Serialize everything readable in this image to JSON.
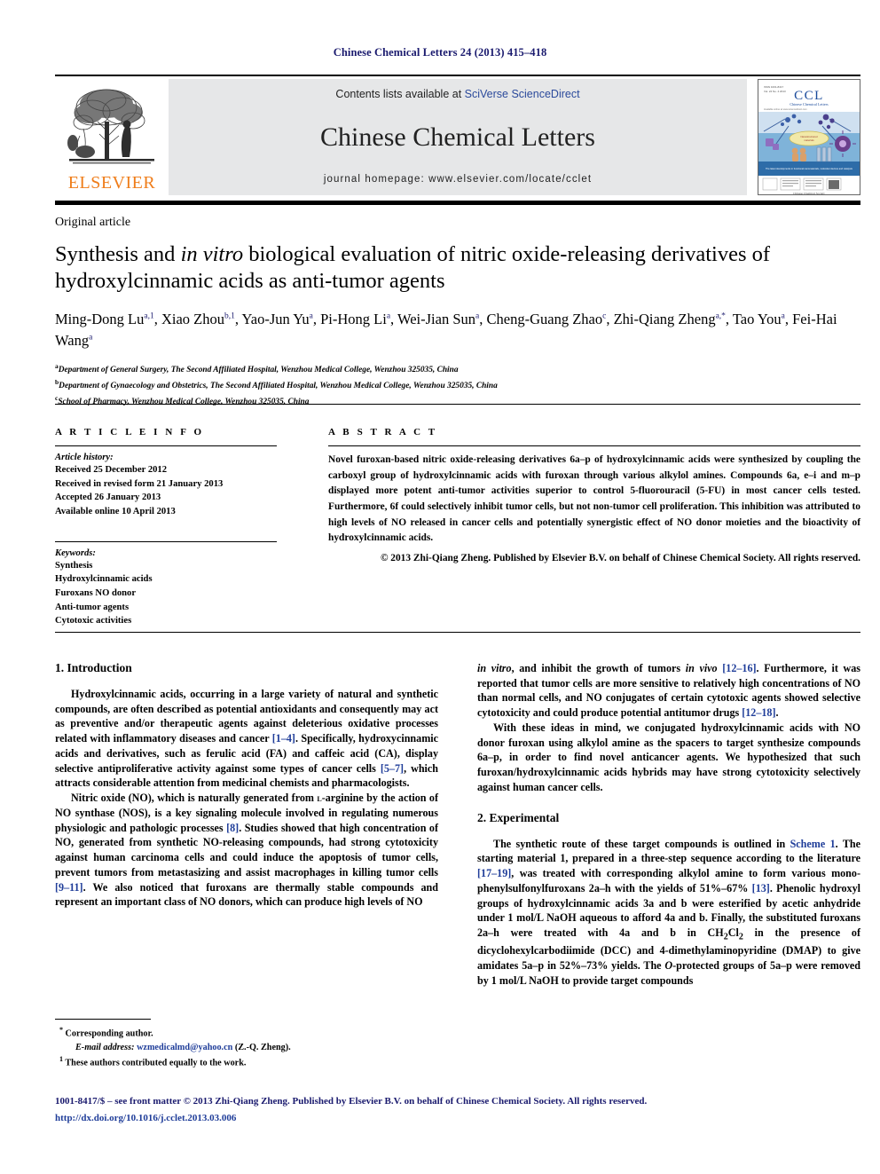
{
  "running_head": "Chinese Chemical Letters 24 (2013) 415–418",
  "masthead": {
    "contents_prefix": "Contents lists available at ",
    "sciencedirect_link": "SciVerse ScienceDirect",
    "journal_name": "Chinese Chemical Letters",
    "homepage": "journal homepage: www.elsevier.com/locate/cclet",
    "publisher_wordmark": "ELSEVIER",
    "cover_title": "CCL",
    "cover_subtitle": "Chinese Chemical Letters"
  },
  "article": {
    "type": "Original article",
    "title_part1": "Synthesis and ",
    "title_italic": "in vitro",
    "title_part2": " biological evaluation of nitric oxide-releasing derivatives of hydroxylcinnamic acids as anti-tumor agents",
    "authors": [
      {
        "name": "Ming-Dong Lu",
        "sup": "a,1",
        "sep": ", "
      },
      {
        "name": "Xiao Zhou",
        "sup": "b,1",
        "sep": ", "
      },
      {
        "name": "Yao-Jun Yu",
        "sup": "a",
        "sep": ", "
      },
      {
        "name": "Pi-Hong Li",
        "sup": "a",
        "sep": ", "
      },
      {
        "name": "Wei-Jian Sun",
        "sup": "a",
        "sep": ", "
      },
      {
        "name": "Cheng-Guang Zhao",
        "sup": "c",
        "sep": ", "
      },
      {
        "name": "Zhi-Qiang Zheng",
        "sup": "a,*",
        "sep": ", "
      },
      {
        "name": "Tao You",
        "sup": "a",
        "sep": ", "
      },
      {
        "name": "Fei-Hai Wang",
        "sup": "a",
        "sep": ""
      }
    ],
    "affiliations": [
      {
        "mark": "a",
        "text": "Department of General Surgery, The Second Affiliated Hospital, Wenzhou Medical College, Wenzhou 325035, China"
      },
      {
        "mark": "b",
        "text": "Department of Gynaecology and Obstetrics, The Second Affiliated Hospital, Wenzhou Medical College, Wenzhou 325035, China"
      },
      {
        "mark": "c",
        "text": "School of Pharmacy, Wenzhou Medical College, Wenzhou 325035, China"
      }
    ]
  },
  "article_info": {
    "heading": "A R T I C L E   I N F O",
    "history_label": "Article history:",
    "history": [
      "Received 25 December 2012",
      "Received in revised form 21 January 2013",
      "Accepted 26 January 2013",
      "Available online 10 April 2013"
    ],
    "keywords_label": "Keywords:",
    "keywords": [
      "Synthesis",
      "Hydroxylcinnamic acids",
      "Furoxans NO donor",
      "Anti-tumor agents",
      "Cytotoxic activities"
    ]
  },
  "abstract": {
    "heading": "A B S T R A C T",
    "body": "Novel furoxan-based nitric oxide-releasing derivatives 6a–p of hydroxylcinnamic acids were synthesized by coupling the carboxyl group of hydroxylcinnamic acids with furoxan through various alkylol amines. Compounds 6a, e–i and m–p displayed more potent anti-tumor activities superior to control 5-fluorouracil (5-FU) in most cancer cells tested. Furthermore, 6f could selectively inhibit tumor cells, but not non-tumor cell proliferation. This inhibition was attributed to high levels of NO released in cancer cells and potentially synergistic effect of NO donor moieties and the bioactivity of hydroxylcinnamic acids.",
    "copyright": "© 2013 Zhi-Qiang Zheng. Published by Elsevier B.V. on behalf of Chinese Chemical Society. All rights reserved."
  },
  "sections": {
    "intro_title": "1. Introduction",
    "intro_p1": "Hydroxylcinnamic acids, occurring in a large variety of natural and synthetic compounds, are often described as potential antioxidants and consequently may act as preventive and/or therapeutic agents against deleterious oxidative processes related with inflammatory diseases and cancer [1–4]. Specifically, hydroxycinnamic acids and derivatives, such as ferulic acid (FA) and caffeic acid (CA), display selective antiproliferative activity against some types of cancer cells [5–7], which attracts considerable attention from medicinal chemists and pharmacologists.",
    "intro_p2": "Nitric oxide (NO), which is naturally generated from L-arginine by the action of NO synthase (NOS), is a key signaling molecule involved in regulating numerous physiologic and pathologic processes [8]. Studies showed that high concentration of NO, generated from synthetic NO-releasing compounds, had strong cytotoxicity against human carcinoma cells and could induce the apoptosis of tumor cells, prevent tumors from metastasizing and assist macrophages in killing tumor cells [9–11]. We also noticed that furoxans are thermally stable compounds and represent an important class of NO donors, which can produce high levels of NO",
    "intro_p2_cont": "in vitro, and inhibit the growth of tumors in vivo [12–16]. Furthermore, it was reported that tumor cells are more sensitive to relatively high concentrations of NO than normal cells, and NO conjugates of certain cytotoxic agents showed selective cytotoxicity and could produce potential antitumor drugs [12–18].",
    "intro_p3": "With these ideas in mind, we conjugated hydroxylcinnamic acids with NO donor furoxan using alkylol amine as the spacers to target synthesize compounds 6a–p, in order to find novel anticancer agents. We hypothesized that such furoxan/hydroxylcinnamic acids hybrids may have strong cytotoxicity selectively against human cancer cells.",
    "exp_title": "2. Experimental",
    "exp_p1": "The synthetic route of these target compounds is outlined in Scheme 1. The starting material 1, prepared in a three-step sequence according to the literature [17–19], was treated with corresponding alkylol amine to form various mono-phenylsulfonylfuroxans 2a–h with the yields of 51%–67% [13]. Phenolic hydroxyl groups of hydroxylcinnamic acids 3a and b were esterified by acetic anhydride under 1 mol/L NaOH aqueous to afford 4a and b. Finally, the substituted furoxans 2a–h were treated with 4a and b in CH2Cl2 in the presence of dicyclohexylcarbodiimide (DCC) and 4-dimethylaminopyridine (DMAP) to give amidates 5a–p in 52%–73% yields. The O-protected groups of 5a–p were removed by 1 mol/L NaOH to provide target compounds"
  },
  "footnotes": {
    "corresponding": "Corresponding author.",
    "email_label": "E-mail address:",
    "email": "wzmedicalmd@yahoo.cn",
    "email_attrib": " (Z.-Q. Zheng).",
    "equal_contrib": "These authors contributed equally to the work."
  },
  "imprint": {
    "line1": "1001-8417/$ – see front matter © 2013 Zhi-Qiang Zheng. Published by Elsevier B.V. on behalf of Chinese Chemical Society. All rights reserved.",
    "doi": "http://dx.doi.org/10.1016/j.cclet.2013.03.006"
  },
  "colors": {
    "link_blue": "#1f3d99",
    "heading_navy": "#1a1a6e",
    "elsevier_orange": "#ef7d1a",
    "band_gray": "#e6e7e8"
  }
}
